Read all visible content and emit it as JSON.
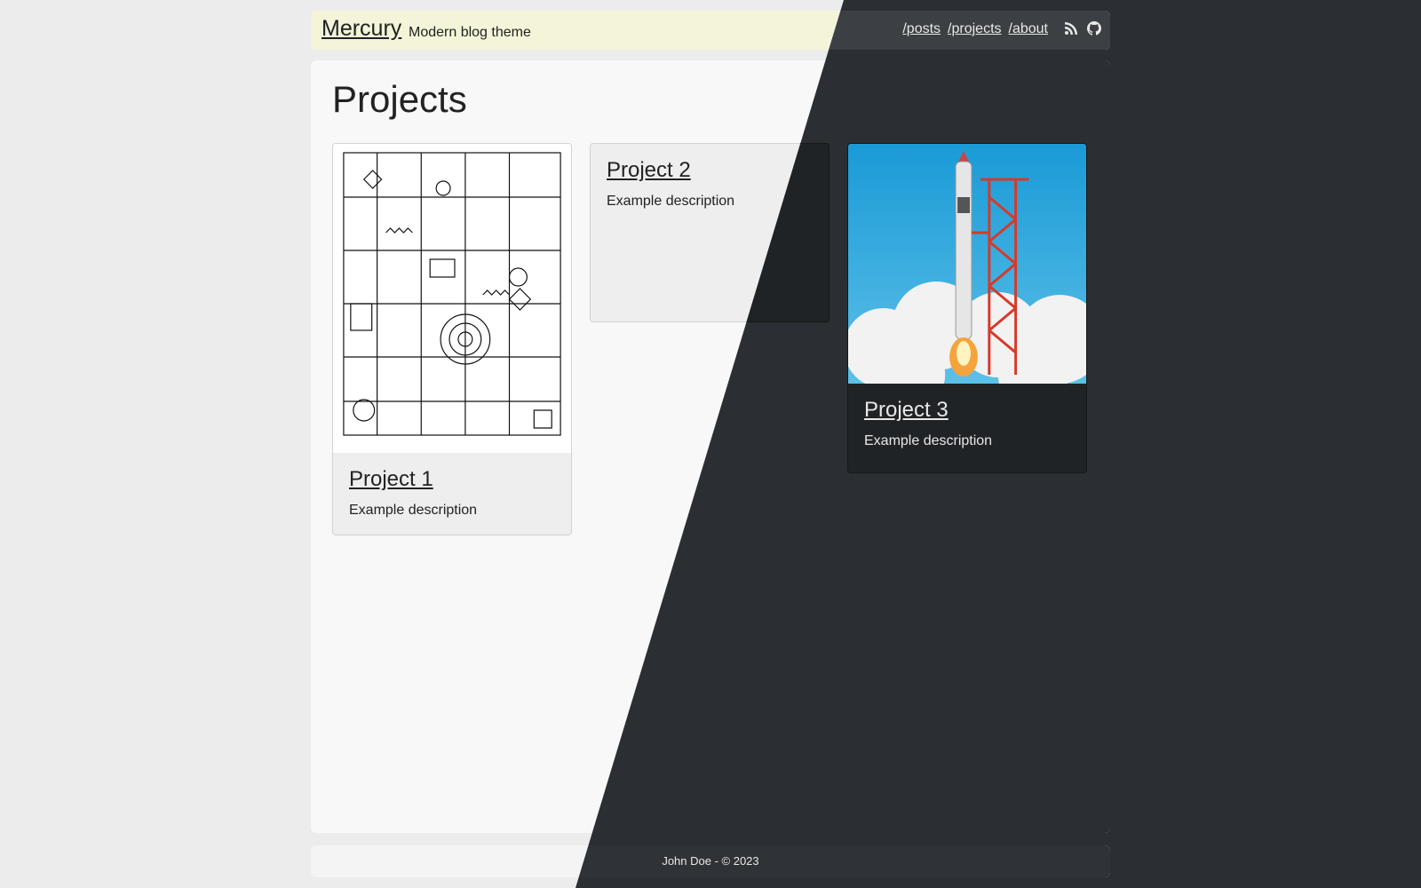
{
  "header": {
    "logo": "Mercury",
    "tagline": "Modern blog theme",
    "nav": [
      "/posts",
      "/projects",
      "/about"
    ],
    "icons": [
      "rss-icon",
      "github-icon"
    ]
  },
  "main": {
    "title": "Projects",
    "projects": [
      {
        "title": "Project 1",
        "description": "Example description",
        "image": "circuit-diagram-drawing"
      },
      {
        "title": "Project 2",
        "description": "Example description"
      },
      {
        "title": "Project 3",
        "description": "Example description",
        "image": "rocket-launch-photo"
      }
    ]
  },
  "footer": {
    "text": "John Doe - © 2023"
  },
  "colors": {
    "light_bg": "#ececec",
    "dark_bg": "#2b2e32",
    "header_light": "#f4f4d9"
  }
}
